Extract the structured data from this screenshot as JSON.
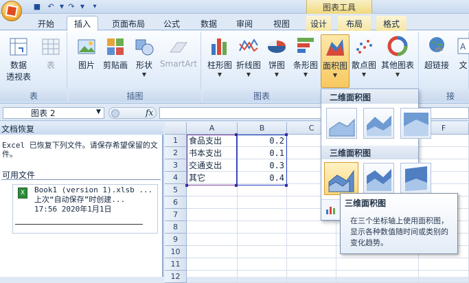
{
  "title_bar": {
    "chart_tools": "图表工具"
  },
  "tabs": [
    {
      "label": "开始"
    },
    {
      "label": "插入"
    },
    {
      "label": "页面布局"
    },
    {
      "label": "公式"
    },
    {
      "label": "数据"
    },
    {
      "label": "审阅"
    },
    {
      "label": "视图"
    },
    {
      "label": "设计"
    },
    {
      "label": "布局"
    },
    {
      "label": "格式"
    }
  ],
  "ribbon": {
    "groups": [
      {
        "label": "表",
        "buttons": [
          {
            "label": "数据",
            "label2": "透视表",
            "icon": "pivot-table-icon"
          },
          {
            "label": "表",
            "icon": "table-icon"
          }
        ]
      },
      {
        "label": "插图",
        "buttons": [
          {
            "label": "图片",
            "icon": "picture-icon"
          },
          {
            "label": "剪贴画",
            "icon": "clip-art-icon"
          },
          {
            "label": "形状",
            "icon": "shapes-icon"
          },
          {
            "label": "SmartArt",
            "icon": "smartart-icon"
          }
        ]
      },
      {
        "label": "图表",
        "buttons": [
          {
            "label": "柱形图",
            "icon": "column-chart-icon"
          },
          {
            "label": "折线图",
            "icon": "line-chart-icon"
          },
          {
            "label": "饼图",
            "icon": "pie-chart-icon"
          },
          {
            "label": "条形图",
            "icon": "bar-chart-icon"
          },
          {
            "label": "面积图",
            "icon": "area-chart-icon"
          },
          {
            "label": "散点图",
            "icon": "scatter-chart-icon"
          },
          {
            "label": "其他图表",
            "icon": "other-charts-icon"
          }
        ]
      },
      {
        "label": "接",
        "buttons": [
          {
            "label": "超链接",
            "icon": "hyperlink-icon"
          },
          {
            "label": "文",
            "icon": "text-box-icon"
          }
        ]
      }
    ]
  },
  "formula_bar": {
    "name_box": "图表 2",
    "fx": "fx"
  },
  "recovery": {
    "title": "文档恢复",
    "description": "Excel 已恢复下列文件。请保存希望保留的文件。",
    "available_label": "可用文件",
    "file": {
      "name": "Book1 (version 1).xlsb ...",
      "line2": "上次“自动保存”时创建...",
      "line3": "17:56 2020年1月1日"
    }
  },
  "sheet": {
    "columns": [
      "A",
      "B",
      "C",
      "F"
    ],
    "rows": [
      "1",
      "2",
      "3",
      "4",
      "5",
      "6",
      "7",
      "8",
      "9",
      "10",
      "11",
      "12"
    ],
    "data": [
      {
        "label": "食品支出",
        "value": "0.2"
      },
      {
        "label": "书本支出",
        "value": "0.1"
      },
      {
        "label": "交通支出",
        "value": "0.3"
      },
      {
        "label": "其它",
        "value": "0.4"
      }
    ]
  },
  "gallery": {
    "section_2d": "二维面积图",
    "section_3d": "三维面积图"
  },
  "tooltip": {
    "title": "三维面积图",
    "body": "在三个坐标轴上使用面积图，显示各种数值随时间或类别的变化趋势。"
  },
  "colors": {
    "accent": "#f4b136",
    "selection": "#3a2aa8"
  }
}
